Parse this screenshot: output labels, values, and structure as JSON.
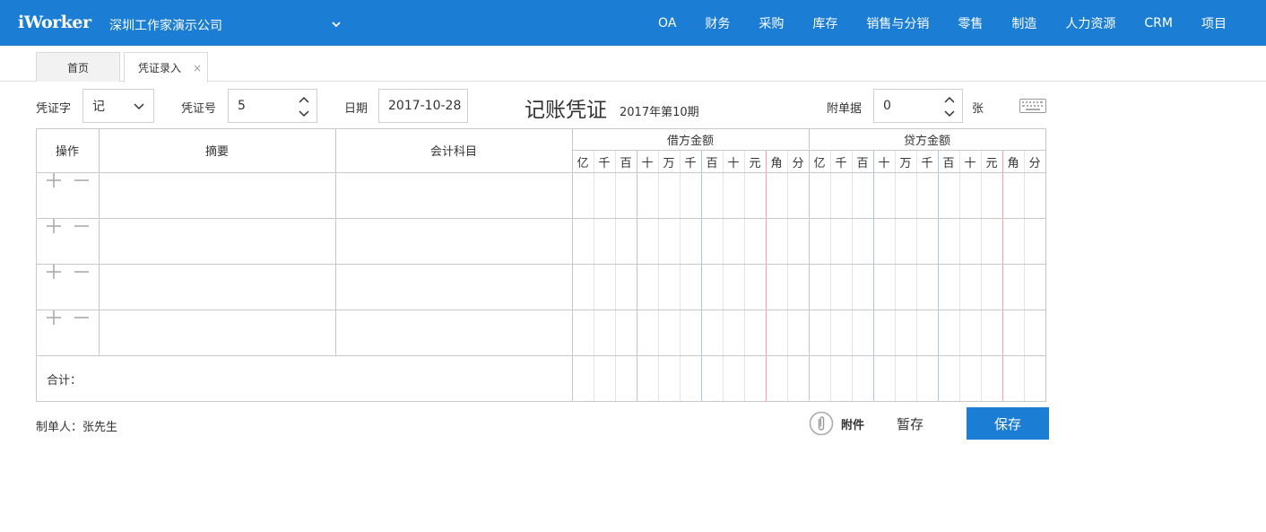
{
  "header": {
    "logo": "iWorker",
    "company": "深圳工作家演示公司",
    "nav": [
      "OA",
      "财务",
      "采购",
      "库存",
      "销售与分销",
      "零售",
      "制造",
      "人力资源",
      "CRM",
      "项目"
    ]
  },
  "tabs": [
    {
      "label": "首页",
      "active": false
    },
    {
      "label": "凭证录入",
      "active": true,
      "closable": true,
      "close_glyph": "×"
    }
  ],
  "form": {
    "voucher_type_label": "凭证字",
    "voucher_type_value": "记",
    "voucher_no_label": "凭证号",
    "voucher_no_value": "5",
    "date_label": "日期",
    "date_value": "2017-10-28",
    "title": "记账凭证",
    "period": "2017年第10期",
    "attachments_label": "附单据",
    "attachments_value": "0",
    "attachments_unit": "张"
  },
  "grid": {
    "col_operation": "操作",
    "col_summary": "摘要",
    "col_account": "会计科目",
    "debit_header": "借方金额",
    "credit_header": "贷方金额",
    "digits": [
      "亿",
      "千",
      "百",
      "十",
      "万",
      "千",
      "百",
      "十",
      "元",
      "角",
      "分"
    ],
    "row_count": 4,
    "total_label": "合计："
  },
  "footer": {
    "maker": "制单人：张先生",
    "attachment_button": "附件",
    "draft_button": "暂存",
    "save_button": "保存"
  },
  "colors": {
    "primary": "#1b7dd3",
    "grid_line": "#c8c8c8",
    "digit_line": "#e3e3e3",
    "group_line": "#a9c7ee",
    "unit_line": "#f0a0a0"
  },
  "icons": {
    "company_dropdown": "chevron-down-icon",
    "add_row": "plus-icon",
    "remove_row": "minus-icon",
    "keyboard": "keyboard-icon",
    "attachment": "paperclip-icon"
  }
}
